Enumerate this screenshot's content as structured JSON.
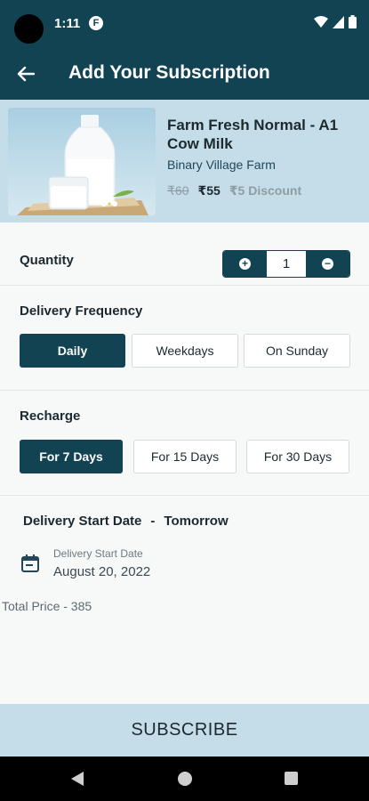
{
  "status_bar": {
    "time": "1:11",
    "notif_badge": "F"
  },
  "app_bar": {
    "title": "Add Your Subscription"
  },
  "product": {
    "name": "Farm Fresh Normal - A1 Cow Milk",
    "farm": "Binary Village Farm",
    "price_original": "₹60",
    "price_current": "₹55",
    "discount": "₹5 Discount"
  },
  "quantity": {
    "label": "Quantity",
    "value": "1"
  },
  "frequency": {
    "label": "Delivery Frequency",
    "options": [
      "Daily",
      "Weekdays",
      "On Sunday"
    ],
    "selected": "Daily"
  },
  "recharge": {
    "label": "Recharge",
    "options": [
      "For 7 Days",
      "For 15 Days",
      "For 30 Days"
    ],
    "selected": "For 7 Days"
  },
  "start_date": {
    "heading": "Delivery Start Date",
    "separator": "-",
    "heading_value": "Tomorrow",
    "caption": "Delivery Start Date",
    "value": "August 20, 2022"
  },
  "total": {
    "text": "Total Price - 385"
  },
  "subscribe": {
    "label": "SUBSCRIBE"
  },
  "colors": {
    "primary": "#124352",
    "light": "#c5dce9"
  }
}
